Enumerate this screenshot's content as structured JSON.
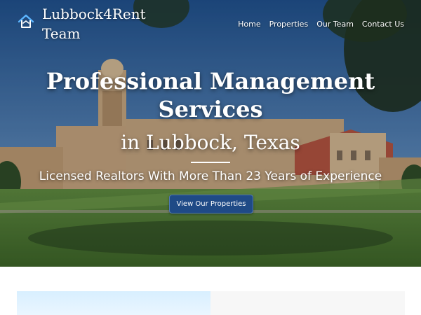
{
  "brand": {
    "line1": "Lubbock4Rent",
    "line2": "Team",
    "logo_icon": "house-icon"
  },
  "nav": {
    "items": [
      {
        "label": "Home"
      },
      {
        "label": "Properties"
      },
      {
        "label": "Our Team"
      },
      {
        "label": "Contact Us"
      }
    ]
  },
  "hero": {
    "headline_line1": "Professional Management",
    "headline_line2": "Services",
    "subhead": "in Lubbock, Texas",
    "tagline": "Licensed Realtors With More Than 23 Years of Experience",
    "cta_label": "View Our Properties"
  },
  "colors": {
    "cta_background": "#1f4a86",
    "text": "#ffffff",
    "card_left": "#d8efff",
    "card_right": "#f7f7f7"
  }
}
